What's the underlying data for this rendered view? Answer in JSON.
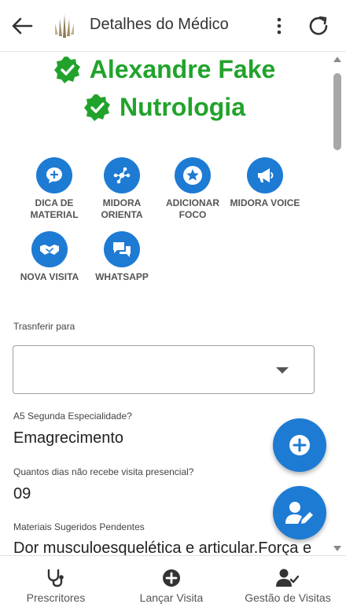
{
  "appbar": {
    "title": "Detalhes do Médico",
    "back_icon": "arrow-left-icon",
    "more_icon": "more-vert-icon",
    "refresh_icon": "refresh-icon"
  },
  "doctor": {
    "name": "Alexandre Fake",
    "specialty": "Nutrologia",
    "verified_color": "#21a32b"
  },
  "actions": [
    {
      "label": "DICA DE MATERIAL",
      "icon": "chat-plus-icon"
    },
    {
      "label": "MIDORA ORIENTA",
      "icon": "share-network-icon"
    },
    {
      "label": "ADICIONAR FOCO",
      "icon": "star-icon"
    },
    {
      "label": "MIDORA VOICE",
      "icon": "megaphone-icon"
    },
    {
      "label": "NOVA VISITA",
      "icon": "handshake-icon"
    },
    {
      "label": "WHATSAPP",
      "icon": "chat-bubbles-icon"
    }
  ],
  "transfer": {
    "label": "Trasnferir para",
    "value": ""
  },
  "fields": [
    {
      "label": "A5 Segunda Especialidade?",
      "value": "Emagrecimento"
    },
    {
      "label": "Quantos dias não recebe visita presencial?",
      "value": "09"
    },
    {
      "label": "Materiais Sugeridos Pendentes",
      "value": "Dor musculoesquelética e articular.Força e"
    }
  ],
  "fabs": [
    {
      "icon": "plus-circle-icon"
    },
    {
      "icon": "user-edit-icon"
    }
  ],
  "bottom_nav": [
    {
      "label": "Prescritores",
      "icon": "stethoscope-icon"
    },
    {
      "label": "Lançar Visita",
      "icon": "plus-circle-icon"
    },
    {
      "label": "Gestão de Visitas",
      "icon": "user-check-icon"
    }
  ],
  "colors": {
    "accent": "#1e7bd3",
    "verified": "#21a32b"
  }
}
